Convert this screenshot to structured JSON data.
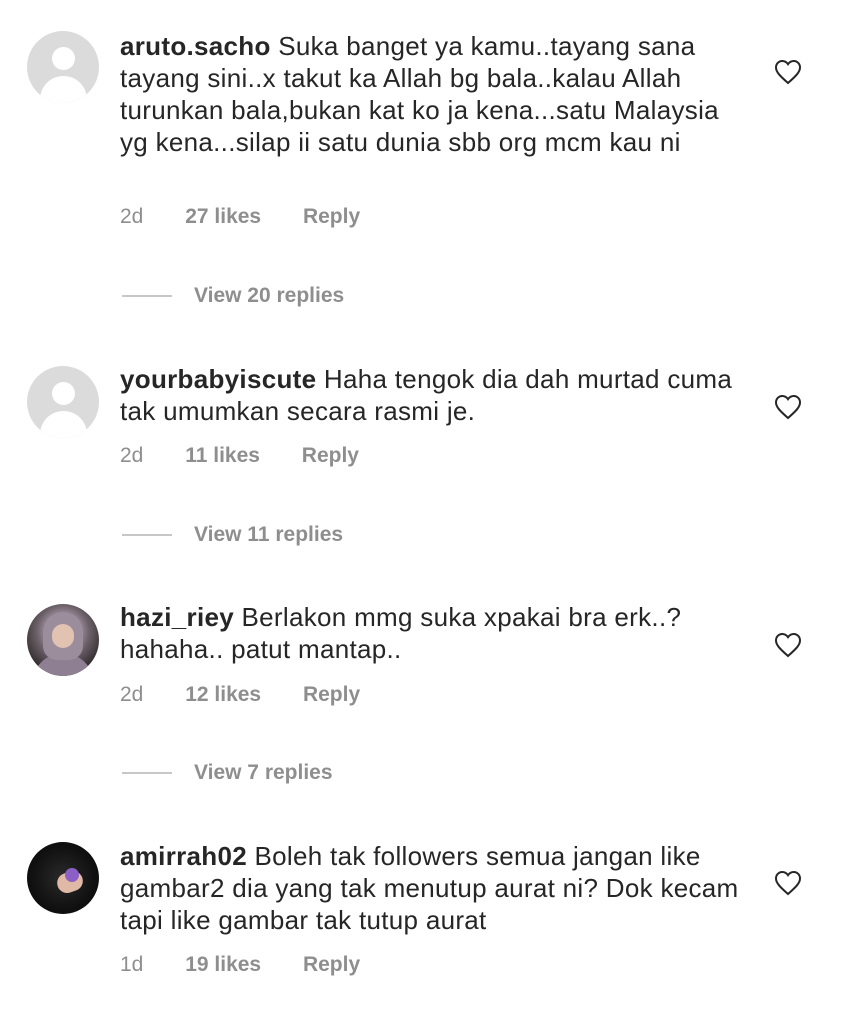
{
  "comments": [
    {
      "username": "aruto.sacho",
      "text": "Suka banget ya kamu..tayang sana tayang sini..x takut ka Allah bg bala..kalau Allah turunkan bala,bukan kat ko ja kena...satu Malaysia yg kena...silap ii satu dunia sbb org mcm  kau ni",
      "time": "2d",
      "likes": "27 likes",
      "reply": "Reply",
      "view_replies": "View 20 replies",
      "avatar": "default-avatar"
    },
    {
      "username": "yourbabyiscute",
      "text": "Haha tengok dia dah murtad cuma tak umumkan secara rasmi je.",
      "time": "2d",
      "likes": "11 likes",
      "reply": "Reply",
      "view_replies": "View 11 replies",
      "avatar": "default-avatar"
    },
    {
      "username": "hazi_riey",
      "text": "Berlakon mmg suka xpakai bra erk..? hahaha.. patut mantap..",
      "time": "2d",
      "likes": "12 likes",
      "reply": "Reply",
      "view_replies": "View 7 replies",
      "avatar": "photo-avatar"
    },
    {
      "username": "amirrah02",
      "text": "Boleh tak followers semua jangan like gambar2 dia yang tak menutup aurat ni? Dok kecam tapi like gambar tak tutup aurat",
      "time": "1d",
      "likes": "19 likes",
      "reply": "Reply",
      "avatar": "photo-avatar"
    }
  ],
  "colors": {
    "text": "#262626",
    "secondary": "#8e8e8e",
    "avatar_placeholder": "#dbdbdb"
  },
  "icons": {
    "like": "heart-outline-icon"
  }
}
